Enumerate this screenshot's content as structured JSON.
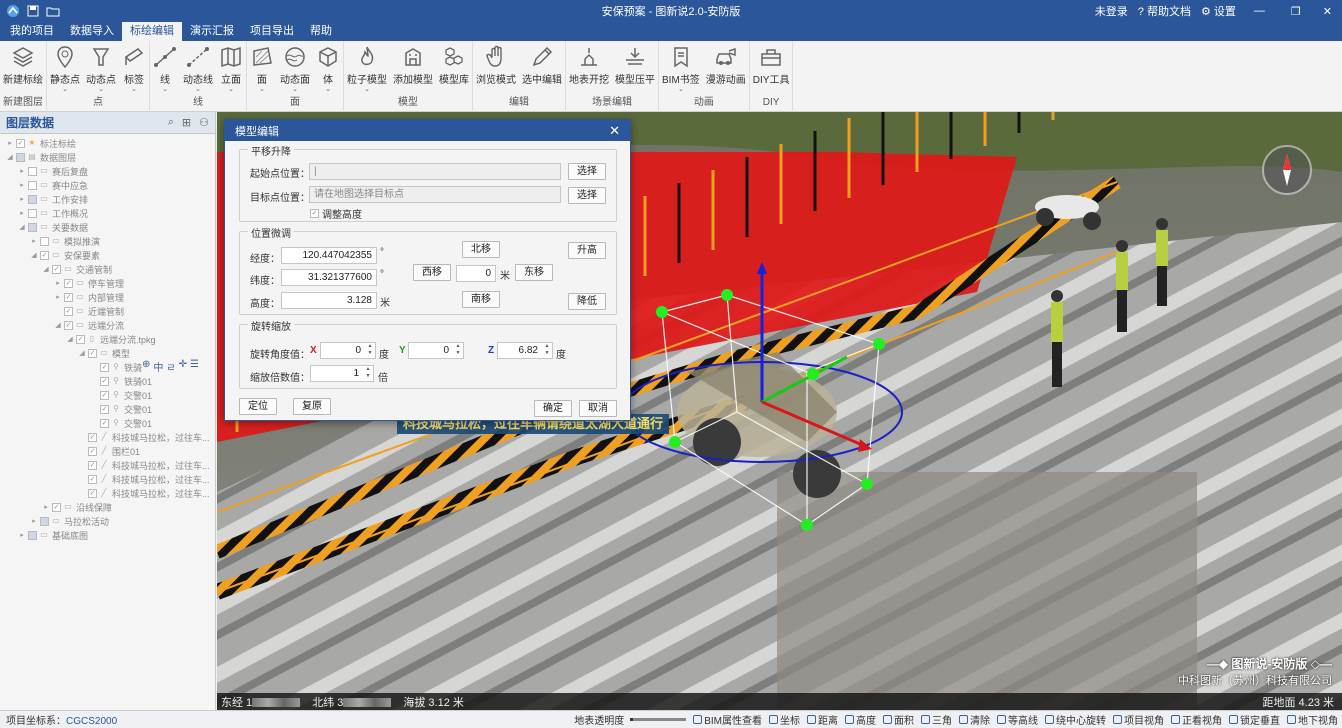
{
  "titlebar": {
    "title": "安保预案 - 图新说2.0-安防版",
    "login": "未登录",
    "help": "帮助文档",
    "settings": "设置"
  },
  "menu": {
    "items": [
      "我的项目",
      "数据导入",
      "标绘编辑",
      "演示汇报",
      "项目导出",
      "帮助"
    ],
    "active": "标绘编辑"
  },
  "ribbon": {
    "groups": [
      {
        "label": "新建图层",
        "buttons": [
          {
            "label": "新建标绘",
            "icon": "layers-icon",
            "dropdown": false
          }
        ]
      },
      {
        "label": "点",
        "buttons": [
          {
            "label": "静态点",
            "icon": "map-pin-icon",
            "dropdown": true
          },
          {
            "label": "动态点",
            "icon": "beacon-icon",
            "dropdown": true
          },
          {
            "label": "标签",
            "icon": "tag-icon",
            "dropdown": true
          }
        ]
      },
      {
        "label": "线",
        "buttons": [
          {
            "label": "线",
            "icon": "line-icon",
            "dropdown": true
          },
          {
            "label": "动态线",
            "icon": "dynamic-line-icon",
            "dropdown": true
          },
          {
            "label": "立面",
            "icon": "facade-icon",
            "dropdown": true
          }
        ]
      },
      {
        "label": "面",
        "buttons": [
          {
            "label": "面",
            "icon": "polygon-icon",
            "dropdown": true
          },
          {
            "label": "动态面",
            "icon": "wave-icon",
            "dropdown": true
          },
          {
            "label": "体",
            "icon": "cube-icon",
            "dropdown": true
          }
        ]
      },
      {
        "label": "模型",
        "buttons": [
          {
            "label": "粒子模型",
            "icon": "fire-icon",
            "dropdown": true
          },
          {
            "label": "添加模型",
            "icon": "building-icon",
            "dropdown": false
          },
          {
            "label": "模型库",
            "icon": "model-library-icon",
            "dropdown": false
          }
        ]
      },
      {
        "label": "编辑",
        "buttons": [
          {
            "label": "浏览模式",
            "icon": "hand-icon",
            "dropdown": false
          },
          {
            "label": "选中编辑",
            "icon": "pencil-icon",
            "dropdown": false
          }
        ]
      },
      {
        "label": "场景编辑",
        "buttons": [
          {
            "label": "地表开挖",
            "icon": "excavate-icon",
            "dropdown": false
          },
          {
            "label": "模型压平",
            "icon": "flatten-icon",
            "dropdown": false
          }
        ]
      },
      {
        "label": "动画",
        "buttons": [
          {
            "label": "BIM书签",
            "icon": "bookmark-icon",
            "dropdown": true
          },
          {
            "label": "漫游动画",
            "icon": "camera-car-icon",
            "dropdown": false
          }
        ]
      },
      {
        "label": "DIY",
        "buttons": [
          {
            "label": "DIY工具",
            "icon": "toolbox-icon",
            "dropdown": false
          }
        ]
      }
    ]
  },
  "layer_panel": {
    "title": "图层数据",
    "tree": [
      {
        "label": "标注标绘",
        "indent": 0,
        "toggle": "expand",
        "icon": "star-icon",
        "checked": "yes"
      },
      {
        "label": "数据图层",
        "indent": 0,
        "toggle": "collapse",
        "icon": "database-icon",
        "checked": "partial"
      },
      {
        "label": "赛后复盘",
        "indent": 1,
        "toggle": "expand",
        "icon": "folder-icon",
        "checked": "no"
      },
      {
        "label": "赛中应急",
        "indent": 1,
        "toggle": "expand",
        "icon": "folder-icon",
        "checked": "no"
      },
      {
        "label": "工作安排",
        "indent": 1,
        "toggle": "expand",
        "icon": "folder-icon",
        "checked": "partial"
      },
      {
        "label": "工作概况",
        "indent": 1,
        "toggle": "expand",
        "icon": "folder-icon",
        "checked": "no"
      },
      {
        "label": "关要数据",
        "indent": 1,
        "toggle": "collapse",
        "icon": "folder-icon",
        "checked": "partial"
      },
      {
        "label": "模拟推演",
        "indent": 2,
        "toggle": "expand",
        "icon": "folder-icon",
        "checked": "no"
      },
      {
        "label": "安保要素",
        "indent": 2,
        "toggle": "collapse",
        "icon": "folder-icon",
        "checked": "yes"
      },
      {
        "label": "交通管制",
        "indent": 3,
        "toggle": "collapse",
        "icon": "folder-icon",
        "checked": "yes"
      },
      {
        "label": "停车管理",
        "indent": 4,
        "toggle": "expand",
        "icon": "folder-icon",
        "checked": "yes"
      },
      {
        "label": "内部管理",
        "indent": 4,
        "toggle": "expand",
        "icon": "folder-icon",
        "checked": "yes"
      },
      {
        "label": "近端管制",
        "indent": 4,
        "toggle": "none",
        "icon": "folder-icon",
        "checked": "yes"
      },
      {
        "label": "远端分流",
        "indent": 4,
        "toggle": "collapse",
        "icon": "folder-icon",
        "checked": "yes"
      },
      {
        "label": "远端分流.tpkg",
        "indent": 5,
        "toggle": "collapse",
        "icon": "file-icon",
        "checked": "yes"
      },
      {
        "label": "模型",
        "indent": 6,
        "toggle": "collapse",
        "icon": "folder-icon",
        "checked": "yes"
      },
      {
        "label": "铁骑",
        "indent": 7,
        "toggle": "none",
        "icon": "pin-icon",
        "checked": "yes"
      },
      {
        "label": "铁骑01",
        "indent": 7,
        "toggle": "none",
        "icon": "pin-icon",
        "checked": "yes"
      },
      {
        "label": "交警01",
        "indent": 7,
        "toggle": "none",
        "icon": "pin-icon",
        "checked": "yes"
      },
      {
        "label": "交警01",
        "indent": 7,
        "toggle": "none",
        "icon": "pin-icon",
        "checked": "yes"
      },
      {
        "label": "交警01",
        "indent": 7,
        "toggle": "none",
        "icon": "pin-icon",
        "checked": "yes"
      },
      {
        "label": "科技城马拉松，过往车...",
        "indent": 6,
        "toggle": "none",
        "icon": "line-icon",
        "checked": "yes"
      },
      {
        "label": "围栏01",
        "indent": 6,
        "toggle": "none",
        "icon": "line-icon",
        "checked": "yes"
      },
      {
        "label": "科技城马拉松，过往车...",
        "indent": 6,
        "toggle": "none",
        "icon": "line-icon",
        "checked": "yes"
      },
      {
        "label": "科技城马拉松，过往车...",
        "indent": 6,
        "toggle": "none",
        "icon": "line-icon",
        "checked": "yes"
      },
      {
        "label": "科技城马拉松，过往车...",
        "indent": 6,
        "toggle": "none",
        "icon": "line-icon",
        "checked": "yes"
      },
      {
        "label": "沿线保障",
        "indent": 3,
        "toggle": "expand",
        "icon": "folder-icon",
        "checked": "yes"
      },
      {
        "label": "马拉松活动",
        "indent": 2,
        "toggle": "expand",
        "icon": "folder-icon",
        "checked": "partial"
      },
      {
        "label": "基础底图",
        "indent": 1,
        "toggle": "expand",
        "icon": "folder-icon",
        "checked": "partial"
      }
    ]
  },
  "dialog": {
    "title": "模型编辑",
    "translate": {
      "legend": "平移升降",
      "start_label": "起始点位置：",
      "start_value": "|",
      "target_label": "目标点位置：",
      "target_placeholder": "请在地图选择目标点",
      "select1": "选择",
      "select2": "选择",
      "adjust_height": "调整高度",
      "adjust_checked": true
    },
    "fine": {
      "legend": "位置微调",
      "lon_label": "经度：",
      "lon_value": "120.447042355",
      "lon_unit": "°",
      "lat_label": "纬度：",
      "lat_value": "31.321377600",
      "lat_unit": "°",
      "alt_label": "高度：",
      "alt_value": "3.128",
      "alt_unit": "米",
      "north": "北移",
      "south": "南移",
      "west": "西移",
      "east": "东移",
      "step_value": "0",
      "step_unit": "米",
      "raise": "升高",
      "lower": "降低"
    },
    "rotate": {
      "legend": "旋转缩放",
      "angle_label": "旋转角度值：",
      "x_label": "X",
      "x_value": "0",
      "y_label": "Y",
      "y_value": "0",
      "z_label": "Z",
      "z_value": "6.82",
      "deg": "度",
      "scale_label": "缩放倍数值：",
      "scale_value": "1",
      "scale_unit": "倍"
    },
    "buttons": {
      "locate": "定位",
      "reset": "复原",
      "ok": "确定",
      "cancel": "取消"
    }
  },
  "viewport": {
    "banner": "科技城马拉松，过往车辆请绕道太湖大道通行",
    "coords": {
      "lon_prefix": "东经 1",
      "lat_prefix": "北纬 3",
      "altitude": "海拔 3.12 米"
    },
    "ground_distance": "距地面 4.23 米",
    "watermark_title": "图新说-安防版",
    "watermark_company": "中科图新（苏州）科技有限公司"
  },
  "statusbar": {
    "coord_label": "项目坐标系：",
    "coord_value": "CGCS2000",
    "transparency_label": "地表透明度",
    "items": [
      "BIM属性查看",
      "坐标",
      "距离",
      "高度",
      "面积",
      "三角",
      "清除",
      "等高线",
      "绕中心旋转",
      "项目视角",
      "正看视角",
      "锁定垂直",
      "地下视角"
    ]
  },
  "colors": {
    "accent": "#2b579a",
    "red_zone": "#e01818",
    "fence_orange": "#f0a020",
    "gizmo_green": "#22ee22"
  }
}
